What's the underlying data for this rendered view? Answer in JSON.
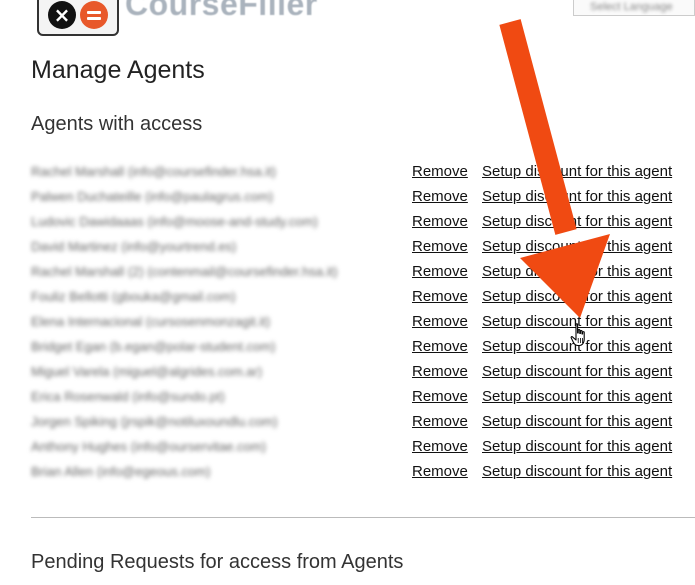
{
  "header": {
    "brand": "CourseFiller",
    "language_select": "Select Language"
  },
  "page_title": "Manage Agents",
  "section_agents_title": "Agents with access",
  "agents": [
    {
      "name": "Rachel Marshall (info@coursefinder.hsa.it)",
      "remove": "Remove",
      "discount": "Setup discount for this agent"
    },
    {
      "name": "Palwen Duchateille (info@paulagrus.com)",
      "remove": "Remove",
      "discount": "Setup discount for this agent"
    },
    {
      "name": "Ludovic Dawidaaas (info@moose-and-study.com)",
      "remove": "Remove",
      "discount": "Setup discount for this agent"
    },
    {
      "name": "David Martinez (info@yourtrend.es)",
      "remove": "Remove",
      "discount": "Setup discount for this agent"
    },
    {
      "name": "Rachel Marshall (2) (contenmail@coursefinder.hsa.it)",
      "remove": "Remove",
      "discount": "Setup discount for this agent"
    },
    {
      "name": "Fouliz Bellotti (gbouka@gmail.com)",
      "remove": "Remove",
      "discount": "Setup discount for this agent"
    },
    {
      "name": "Elena Internacional (cursosenmonzagit.it)",
      "remove": "Remove",
      "discount": "Setup discount for this agent"
    },
    {
      "name": "Bridget Egan (b.egan@polar-student.com)",
      "remove": "Remove",
      "discount": "Setup discount for this agent"
    },
    {
      "name": "Miguel Varela (miguel@algrides.com.ar)",
      "remove": "Remove",
      "discount": "Setup discount for this agent"
    },
    {
      "name": "Erica Rosenwald (info@sundo.pt)",
      "remove": "Remove",
      "discount": "Setup discount for this agent"
    },
    {
      "name": "Jorgen Spiking (jrspik@notiluxoundlu.com)",
      "remove": "Remove",
      "discount": "Setup discount for this agent"
    },
    {
      "name": "Anthony Hughes (info@ourservitae.com)",
      "remove": "Remove",
      "discount": "Setup discount for this agent"
    },
    {
      "name": "Brian Allen (info@egeous.com)",
      "remove": "Remove",
      "discount": "Setup discount for this agent"
    }
  ],
  "section_pending_title": "Pending Requests for access from Agents",
  "colors": {
    "arrow": "#f04a12",
    "logo_accent": "#e8582a",
    "text": "#222222",
    "divider": "#bbbbbb"
  },
  "icons": {
    "logo": "close-and-equals-logo-icon",
    "cursor": "hand-pointer-icon",
    "annotation": "red-arrow-icon"
  }
}
